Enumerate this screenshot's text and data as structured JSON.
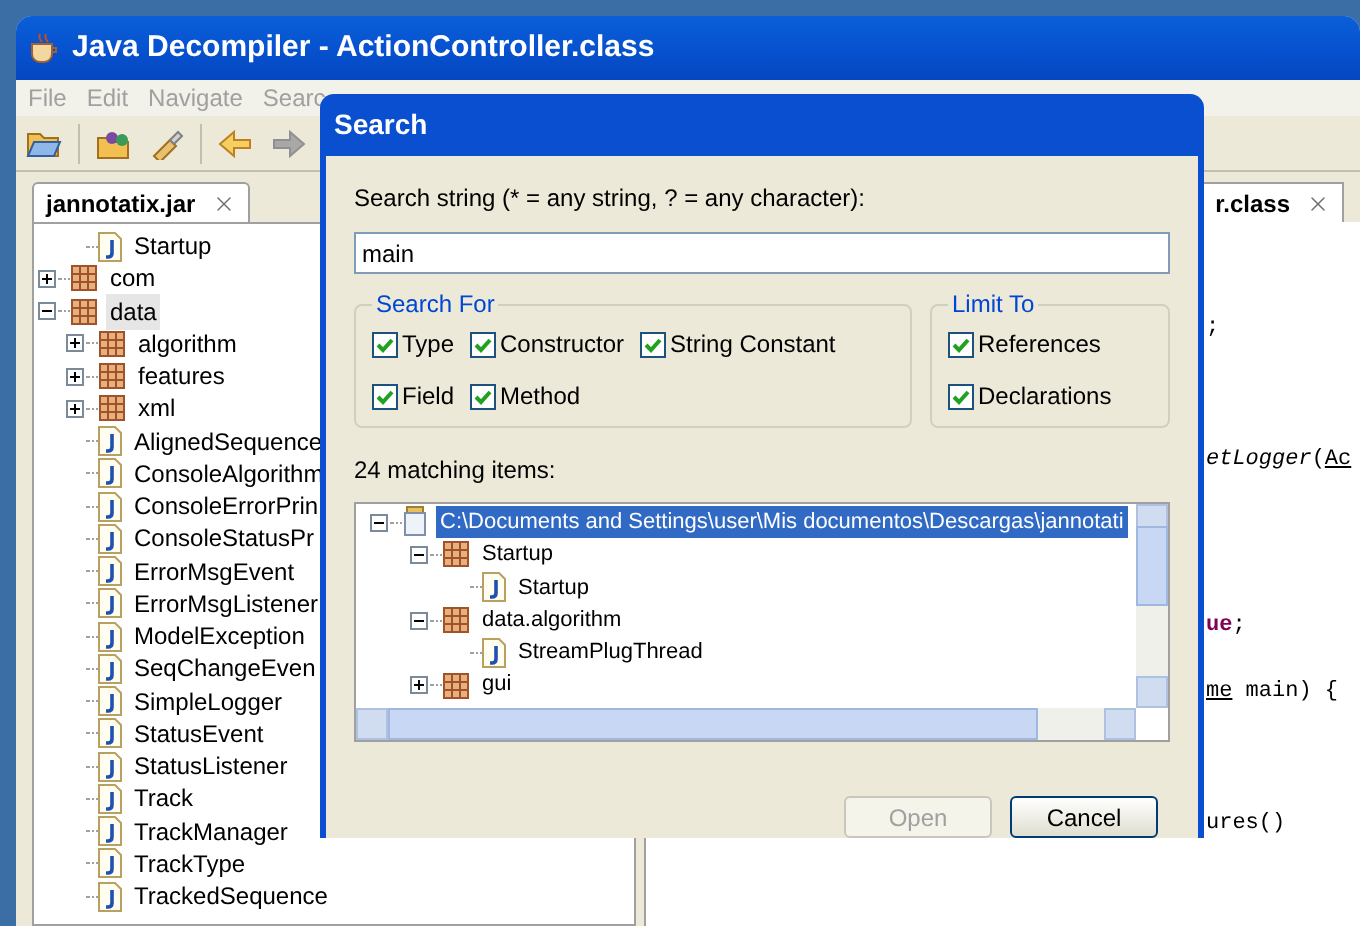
{
  "window": {
    "title": "Java Decompiler - ActionController.class"
  },
  "menu": [
    "File",
    "Edit",
    "Navigate",
    "Searc"
  ],
  "toolbar": [
    {
      "kind": "open"
    },
    {
      "kind": "open-type"
    },
    {
      "kind": "search"
    },
    {
      "kind": "back",
      "disabled": false
    },
    {
      "kind": "forward",
      "disabled": true
    }
  ],
  "left_tab": {
    "label": "jannotatix.jar"
  },
  "tree": [
    {
      "kind": "hidden",
      "children": [
        {
          "label": "Startup",
          "kind": "class",
          "selected": false
        }
      ]
    },
    {
      "label": "com",
      "kind": "package",
      "expanded": false,
      "selected": false
    },
    {
      "label": "data",
      "kind": "package",
      "expanded": true,
      "selected": true,
      "children": [
        {
          "label": "algorithm",
          "kind": "package",
          "expanded": false,
          "selected": false
        },
        {
          "label": "features",
          "kind": "package",
          "expanded": false,
          "selected": false
        },
        {
          "label": "xml",
          "kind": "package",
          "expanded": false,
          "selected": false
        },
        {
          "label": "AlignedSequence",
          "kind": "class",
          "selected": false
        },
        {
          "label": "ConsoleAlgorithm",
          "kind": "class",
          "selected": false
        },
        {
          "label": "ConsoleErrorPrin",
          "kind": "class",
          "selected": false
        },
        {
          "label": "ConsoleStatusPr",
          "kind": "class",
          "selected": false
        },
        {
          "label": "ErrorMsgEvent",
          "kind": "class",
          "selected": false
        },
        {
          "label": "ErrorMsgListener",
          "kind": "class",
          "selected": false
        },
        {
          "label": "ModelException",
          "kind": "class",
          "selected": false
        },
        {
          "label": "SeqChangeEven",
          "kind": "class",
          "selected": false
        },
        {
          "label": "SimpleLogger",
          "kind": "class",
          "selected": false
        },
        {
          "label": "StatusEvent",
          "kind": "class",
          "selected": false
        },
        {
          "label": "StatusListener",
          "kind": "class",
          "selected": false
        },
        {
          "label": "Track",
          "kind": "class",
          "selected": false
        },
        {
          "label": "TrackManager",
          "kind": "class",
          "selected": false
        },
        {
          "label": "TrackType",
          "kind": "class",
          "selected": false
        },
        {
          "label": "TrackedSequence",
          "kind": "class",
          "selected": false
        }
      ]
    }
  ],
  "editor": {
    "tab": "r.class",
    "lines": [
      {
        "kind": "code",
        "segments": [
          {
            "text": ";",
            "kind": "plain"
          }
        ]
      },
      {
        "kind": "blank"
      },
      {
        "kind": "blank"
      },
      {
        "kind": "blank"
      },
      {
        "kind": "code",
        "segments": [
          {
            "text": "etLogger",
            "kind": "italic"
          },
          {
            "text": "(",
            "kind": "plain"
          },
          {
            "text": "Ac",
            "kind": "link"
          }
        ]
      },
      {
        "kind": "blank"
      },
      {
        "kind": "blank"
      },
      {
        "kind": "blank"
      },
      {
        "kind": "blank"
      },
      {
        "kind": "code",
        "segments": [
          {
            "text": "ue",
            "kind": "keyword"
          },
          {
            "text": ";",
            "kind": "plain"
          }
        ]
      },
      {
        "kind": "blank"
      },
      {
        "kind": "code",
        "segments": [
          {
            "text": "me",
            "kind": "link"
          },
          {
            "text": " main) {",
            "kind": "plain"
          }
        ]
      },
      {
        "kind": "blank"
      },
      {
        "kind": "blank"
      },
      {
        "kind": "blank"
      },
      {
        "kind": "code",
        "segments": [
          {
            "text": "ures()",
            "kind": "plain"
          }
        ]
      }
    ]
  },
  "dialog": {
    "title": "Search",
    "prompt": "Search string (* = any string, ? = any character):",
    "query": "main",
    "search_for": {
      "title": "Search For",
      "options": [
        {
          "label": "Type",
          "checked": true
        },
        {
          "label": "Constructor",
          "checked": true
        },
        {
          "label": "String Constant",
          "checked": true
        },
        {
          "label": "Field",
          "checked": true
        },
        {
          "label": "Method",
          "checked": true
        }
      ]
    },
    "limit_to": {
      "title": "Limit To",
      "options": [
        {
          "label": "References",
          "checked": true
        },
        {
          "label": "Declarations",
          "checked": true
        }
      ]
    },
    "result_count": "24 matching items:",
    "results": [
      {
        "label": "C:\\Documents and Settings\\user\\Mis documentos\\Descargas\\jannotati",
        "kind": "jar",
        "expanded": true,
        "selected": true,
        "children": [
          {
            "label": "Startup",
            "kind": "package",
            "expanded": true,
            "selected": false,
            "children": [
              {
                "label": "Startup",
                "kind": "class",
                "selected": false
              }
            ]
          },
          {
            "label": "data.algorithm",
            "kind": "package",
            "expanded": true,
            "selected": false,
            "children": [
              {
                "label": "StreamPlugThread",
                "kind": "class",
                "selected": false
              }
            ]
          },
          {
            "label": "gui",
            "kind": "package",
            "expanded": false,
            "selected": false
          }
        ]
      }
    ],
    "buttons": [
      {
        "label": "Open",
        "disabled": true
      },
      {
        "label": "Cancel",
        "disabled": false
      }
    ]
  }
}
